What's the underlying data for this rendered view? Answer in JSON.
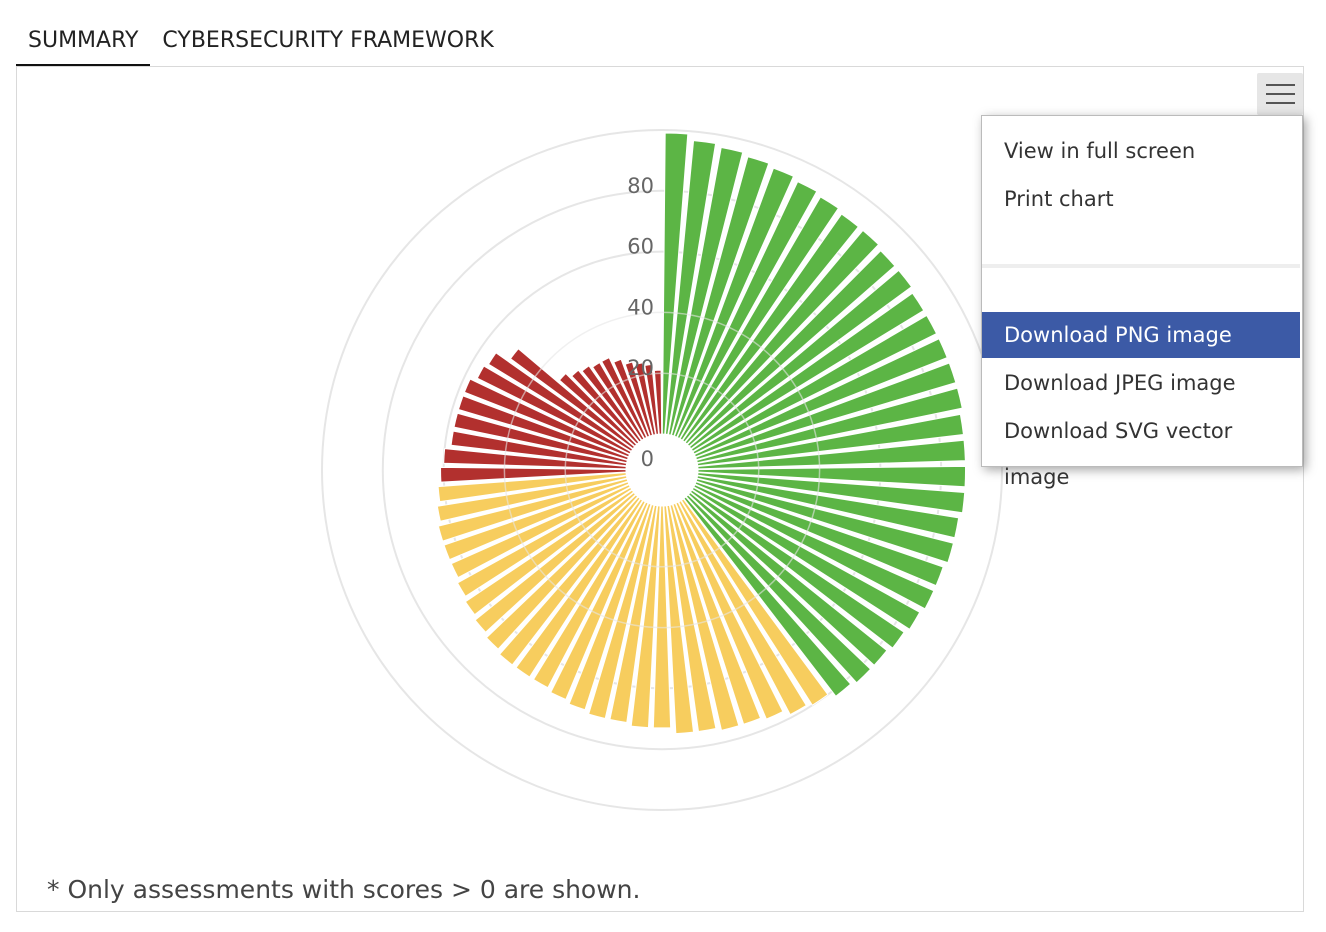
{
  "tabs": [
    {
      "label": "SUMMARY",
      "active": true
    },
    {
      "label": "CYBERSECURITY FRAMEWORK",
      "active": false
    }
  ],
  "export_menu": {
    "button_icon": "hamburger-menu-icon",
    "items": [
      {
        "label": "View in full screen"
      },
      {
        "label": "Print chart"
      },
      {
        "label": "Download PNG image",
        "highlighted": true
      },
      {
        "label": "Download JPEG image"
      },
      {
        "label": "Download SVG vector image"
      }
    ]
  },
  "footnote": "* Only assessments with scores > 0 are shown.",
  "colors": {
    "good": "#5cb545",
    "medium": "#f7cd5e",
    "poor": "#b2302e",
    "grid": "#e6e6e6",
    "highlight": "#3c5aa6"
  },
  "chart_data": {
    "type": "polar-bar",
    "title": "",
    "radial_axis": {
      "min": 0,
      "max": 100,
      "ticks": [
        0,
        20,
        40,
        60,
        80
      ]
    },
    "grid": true,
    "legend": "none",
    "values": [
      99,
      97,
      96,
      95,
      94,
      93,
      92,
      91,
      91,
      90,
      90,
      89,
      89,
      89,
      89,
      89,
      88,
      88,
      88,
      88,
      87,
      87,
      86,
      86,
      85,
      84,
      83,
      83,
      82,
      80,
      79,
      77,
      76,
      76,
      75,
      75,
      73,
      73,
      72,
      72,
      71,
      70,
      69,
      69,
      69,
      68,
      67,
      66,
      65,
      64,
      64,
      64,
      63,
      62,
      61,
      60,
      58,
      58,
      58,
      58,
      56,
      55,
      50,
      33,
      31,
      30,
      29,
      29,
      27,
      25,
      24,
      23,
      21
    ],
    "categories_by_color": [
      {
        "color": "good",
        "count": 29
      },
      {
        "color": "medium",
        "count": 25
      },
      {
        "color": "poor",
        "count": 19
      }
    ]
  }
}
